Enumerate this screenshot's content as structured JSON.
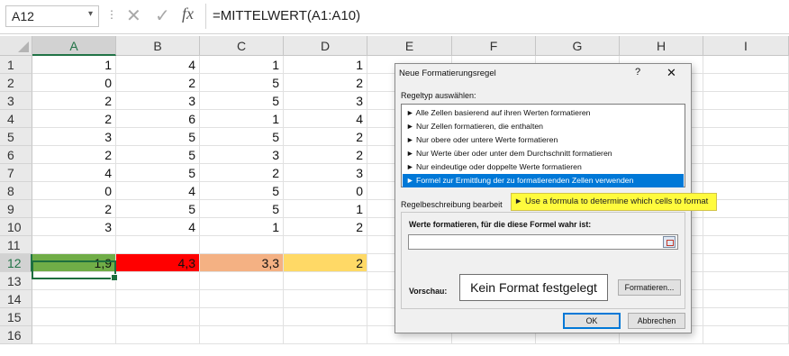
{
  "formula_bar": {
    "name_box": "A12",
    "dropdown_glyph": "▾",
    "separator_glyph": "⋮",
    "cancel_glyph": "✕",
    "enter_glyph": "✓",
    "fx_label": "fx",
    "formula": "=MITTELWERT(A1:A10)"
  },
  "columns": [
    "A",
    "B",
    "C",
    "D",
    "E",
    "F",
    "G",
    "H",
    "I"
  ],
  "rows": [
    "1",
    "2",
    "3",
    "4",
    "5",
    "6",
    "7",
    "8",
    "9",
    "10",
    "11",
    "12",
    "13",
    "14",
    "15",
    "16"
  ],
  "cells": [
    [
      "1",
      "4",
      "1",
      "1"
    ],
    [
      "0",
      "2",
      "5",
      "2"
    ],
    [
      "2",
      "3",
      "5",
      "3"
    ],
    [
      "2",
      "6",
      "1",
      "4"
    ],
    [
      "3",
      "5",
      "5",
      "2"
    ],
    [
      "2",
      "5",
      "3",
      "2"
    ],
    [
      "4",
      "5",
      "2",
      "3"
    ],
    [
      "0",
      "4",
      "5",
      "0"
    ],
    [
      "2",
      "5",
      "5",
      "1"
    ],
    [
      "3",
      "4",
      "1",
      "2"
    ],
    [
      "",
      "",
      "",
      ""
    ],
    [
      "1,9",
      "4,3",
      "3,3",
      "2"
    ]
  ],
  "averages_row_colors": [
    "#70ad47",
    "#ff0000",
    "#f4b183",
    "#ffd966"
  ],
  "dialog": {
    "title": "Neue Formatierungsregel",
    "help": "?",
    "close": "✕",
    "rule_type_label": "Regeltyp auswählen:",
    "rule_types": [
      "► Alle Zellen basierend auf ihren Werten formatieren",
      "► Nur Zellen formatieren, die enthalten",
      "► Nur obere oder untere Werte formatieren",
      "► Nur Werte über oder unter dem Durchschnitt formatieren",
      "► Nur eindeutige oder doppelte Werte formatieren",
      "► Formel zur Ermittlung der zu formatierenden Zellen verwenden"
    ],
    "selected_rule_index": 5,
    "description_label": "Regelbeschreibung bearbeit",
    "formula_label": "Werte formatieren, für die diese Formel wahr ist:",
    "formula_value": "",
    "preview_label": "Vorschau:",
    "preview_text": "Kein Format festgelegt",
    "format_button": "Formatieren...",
    "ok_button": "OK",
    "cancel_button": "Abbrechen",
    "accent": "#0078d7"
  },
  "tooltip": "► Use a formula to determine which cells to format"
}
